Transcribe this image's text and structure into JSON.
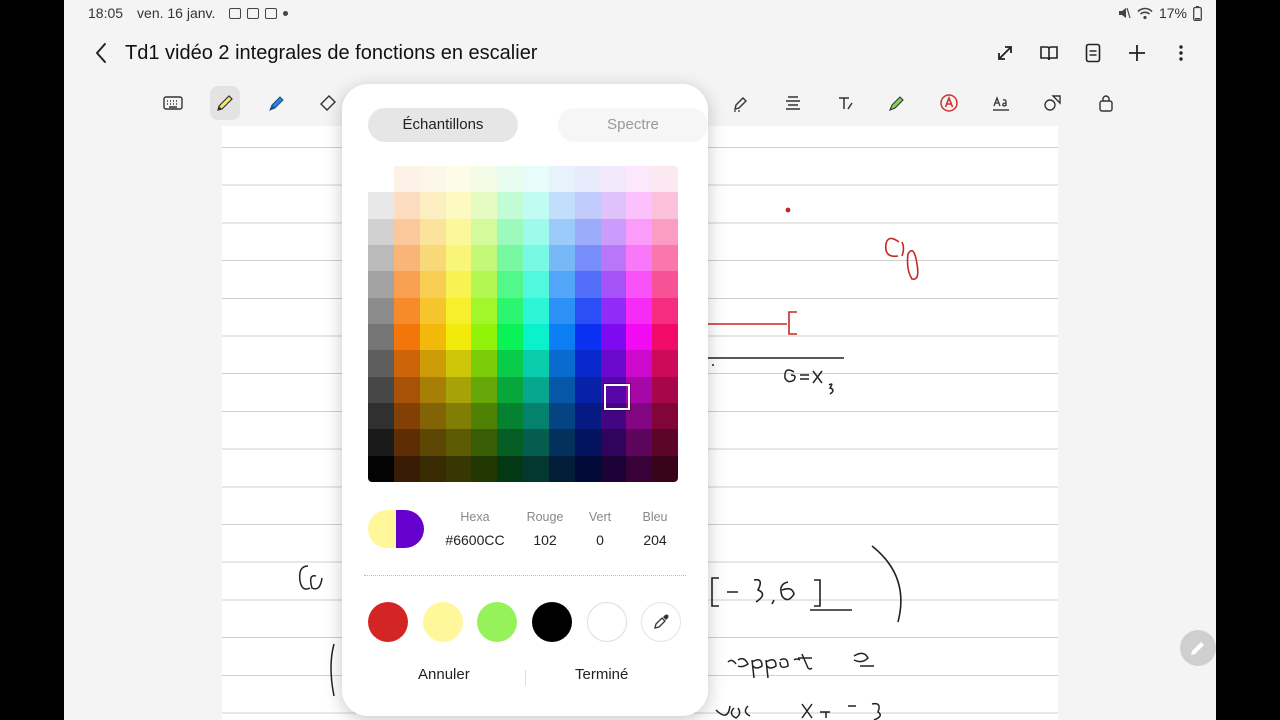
{
  "status": {
    "time": "18:05",
    "date": "ven. 16 janv.",
    "battery": "17%"
  },
  "header": {
    "title": "Td1 vidéo 2 integrales de fonctions en escalier"
  },
  "picker": {
    "tabs": [
      "Échantillons",
      "Spectre"
    ],
    "selected_tab": "Échantillons",
    "hex_label": "Hexa",
    "hex_value": "#6600CC",
    "red_label": "Rouge",
    "red_value": "102",
    "green_label": "Vert",
    "green_value": "0",
    "blue_label": "Bleu",
    "blue_value": "204",
    "current_color": "#6600CC",
    "previous_color": "#FFF799",
    "swatches": [
      "#D42525",
      "#FFF799",
      "#96F25A",
      "#000000",
      "#FFFFFF"
    ],
    "cancel_label": "Annuler",
    "done_label": "Terminé"
  },
  "colors": {
    "ink_red": "#c62828",
    "ink_black": "#1a1a1a"
  }
}
